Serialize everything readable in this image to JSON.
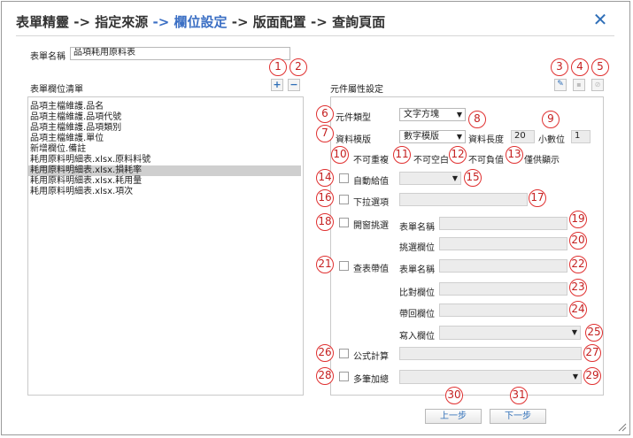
{
  "wizard": {
    "steps": [
      "表單精靈",
      "指定來源",
      "欄位設定",
      "版面配置",
      "查詢頁面"
    ],
    "sep_plain": " -> ",
    "sep_current": " -> "
  },
  "form_name": {
    "label": "表單名稱",
    "value": "品項耗用原料表"
  },
  "field_list": {
    "label": "表單欄位清單",
    "items": [
      "品項主檔維護.品名",
      "品項主檔維護.品項代號",
      "品項主檔維護.品項類別",
      "品項主檔維護.單位",
      "新增欄位.備註",
      "耗用原料明細表.xlsx.原料料號",
      "耗用原料明細表.xlsx.損耗率",
      "耗用原料明細表.xlsx.耗用量",
      "耗用原料明細表.xlsx.項次"
    ],
    "selected_index": 6
  },
  "props": {
    "title": "元件屬性設定",
    "component_type": {
      "label": "元件類型",
      "value": "文字方塊"
    },
    "data_template": {
      "label": "資料模版",
      "value": "數字模版"
    },
    "data_length": {
      "label": "資料長度",
      "value": "20"
    },
    "decimals": {
      "label": "小數位",
      "value": "1"
    },
    "no_duplicate": "不可重複",
    "not_empty": "不可空白",
    "not_negative": "不可負值",
    "display_only": "僅供顯示",
    "auto_value": "自動給值",
    "dropdown_option": "下拉選項",
    "popup_pick": {
      "label": "開窗挑選",
      "table_name": "表單名稱",
      "pick_field": "挑選欄位"
    },
    "lookup": {
      "label": "查表帶值",
      "table_name": "表單名稱",
      "compare_field": "比對欄位",
      "return_field": "帶回欄位",
      "write_field": "寫入欄位"
    },
    "formula": "公式計算",
    "multi_sum": "多筆加總"
  },
  "buttons": {
    "prev": "上一步",
    "next": "下一步"
  },
  "badges": [
    "1",
    "2",
    "3",
    "4",
    "5",
    "6",
    "7",
    "8",
    "9",
    "10",
    "11",
    "12",
    "13",
    "14",
    "15",
    "16",
    "17",
    "18",
    "19",
    "20",
    "21",
    "22",
    "23",
    "24",
    "25",
    "26",
    "27",
    "28",
    "29",
    "30",
    "31"
  ],
  "icons": {
    "add": "plus-icon",
    "remove": "minus-icon",
    "edit": "edit-icon",
    "save": "save-icon",
    "clear": "clear-icon",
    "close": "close-icon"
  },
  "colors": {
    "accent": "#2f6fb8",
    "badge": "#e03030",
    "selected_row": "#cfcfcf"
  }
}
